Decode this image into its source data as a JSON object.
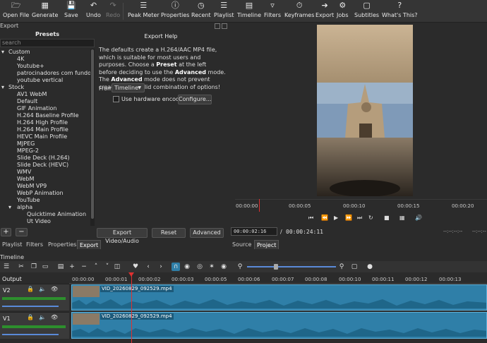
{
  "toolbar": {
    "items": [
      {
        "label": "Open File",
        "icon": "folder-icon"
      },
      {
        "label": "Generate",
        "icon": "generate-icon"
      },
      {
        "label": "Save",
        "icon": "save-icon"
      },
      {
        "label": "Undo",
        "icon": "undo-icon"
      },
      {
        "label": "Redo",
        "icon": "redo-icon"
      },
      {
        "label": "Peak Meter",
        "icon": "peak-meter-icon"
      },
      {
        "label": "Properties",
        "icon": "properties-icon"
      },
      {
        "label": "Recent",
        "icon": "recent-icon"
      },
      {
        "label": "Playlist",
        "icon": "playlist-icon"
      },
      {
        "label": "Timeline",
        "icon": "timeline-icon"
      },
      {
        "label": "Filters",
        "icon": "filters-icon"
      },
      {
        "label": "Keyframes",
        "icon": "keyframes-icon"
      },
      {
        "label": "Export",
        "icon": "export-icon"
      },
      {
        "label": "Jobs",
        "icon": "jobs-icon"
      },
      {
        "label": "Subtitles",
        "icon": "subtitles-icon"
      },
      {
        "label": "What's This?",
        "icon": "help-icon"
      }
    ]
  },
  "export": {
    "dock_title": "Export",
    "presets_title": "Presets",
    "search_placeholder": "search",
    "tree": [
      {
        "label": "Custom",
        "level": 0,
        "expanded": true
      },
      {
        "label": "4K",
        "level": 1
      },
      {
        "label": "Youtube+",
        "level": 1
      },
      {
        "label": "patrocinadores com fundo t...",
        "level": 1
      },
      {
        "label": "youtube vertical",
        "level": 1
      },
      {
        "label": "Stock",
        "level": 0,
        "expanded": true
      },
      {
        "label": "AV1 WebM",
        "level": 1
      },
      {
        "label": "Default",
        "level": 1
      },
      {
        "label": "GIF Animation",
        "level": 1
      },
      {
        "label": "H.264 Baseline Profile",
        "level": 1
      },
      {
        "label": "H.264 High Profile",
        "level": 1
      },
      {
        "label": "H.264 Main Profile",
        "level": 1
      },
      {
        "label": "HEVC Main Profile",
        "level": 1
      },
      {
        "label": "MJPEG",
        "level": 1
      },
      {
        "label": "MPEG-2",
        "level": 1
      },
      {
        "label": "Slide Deck (H.264)",
        "level": 1
      },
      {
        "label": "Slide Deck (HEVC)",
        "level": 1
      },
      {
        "label": "WMV",
        "level": 1
      },
      {
        "label": "WebM",
        "level": 1
      },
      {
        "label": "WebM VP9",
        "level": 1
      },
      {
        "label": "WebP Animation",
        "level": 1
      },
      {
        "label": "YouTube",
        "level": 1
      },
      {
        "label": "alpha",
        "level": 1,
        "expanded": true
      },
      {
        "label": "Quicktime Animation",
        "level": 2
      },
      {
        "label": "Ut Video",
        "level": 2
      }
    ],
    "help_title": "Export Help",
    "help_p1": "The defaults create a H.264/AAC MP4 file, which is suitable for most users and purposes. Choose a",
    "help_preset": "Preset",
    "help_p2": " at the left before deciding to use the",
    "help_advanced1": "Advanced",
    "help_p3": " mode. The ",
    "help_advanced2": "Advanced",
    "help_p4": " mode does not prevent creating an invalid combination of options!",
    "from_label": "From",
    "from_value": "Timeline",
    "hw_encoder_label": "Use hardware encoder",
    "configure_label": "Configure...",
    "export_button": "Export Video/Audio",
    "reset_button": "Reset",
    "advanced_button": "Advanced",
    "add_button": "+",
    "remove_button": "−"
  },
  "left_tabs": [
    "Playlist",
    "Filters",
    "Properties",
    "Export"
  ],
  "left_tab_active": "Export",
  "preview": {
    "ruler_ticks": [
      "00:00:00",
      "00:00:05",
      "00:00:10",
      "00:00:15",
      "00:00:20"
    ],
    "current_time": "00:00:02:16",
    "separator": "/",
    "total_time": "00:00:24:11",
    "in_point": "--:--:--:--",
    "out_point": "--:--:--"
  },
  "right_tabs": [
    "Source",
    "Project"
  ],
  "right_tab_active": "Project",
  "timeline": {
    "title": "Timeline",
    "output_label": "Output",
    "ruler_ticks": [
      "00:00:00",
      "00:00:01",
      "00:00:02",
      "00:00:03",
      "00:00:05",
      "00:00:06",
      "00:00:07",
      "00:00:08",
      "00:00:10",
      "00:00:11",
      "00:00:12",
      "00:00:13"
    ],
    "tracks": [
      {
        "name": "V2",
        "clip": "VID_20260829_092529.mp4"
      },
      {
        "name": "V1",
        "clip": "VID_20260829_092529.mp4"
      }
    ]
  },
  "colors": {
    "accent": "#2f7fa8",
    "playhead": "#e03030",
    "meter": "#2d8f2d"
  }
}
